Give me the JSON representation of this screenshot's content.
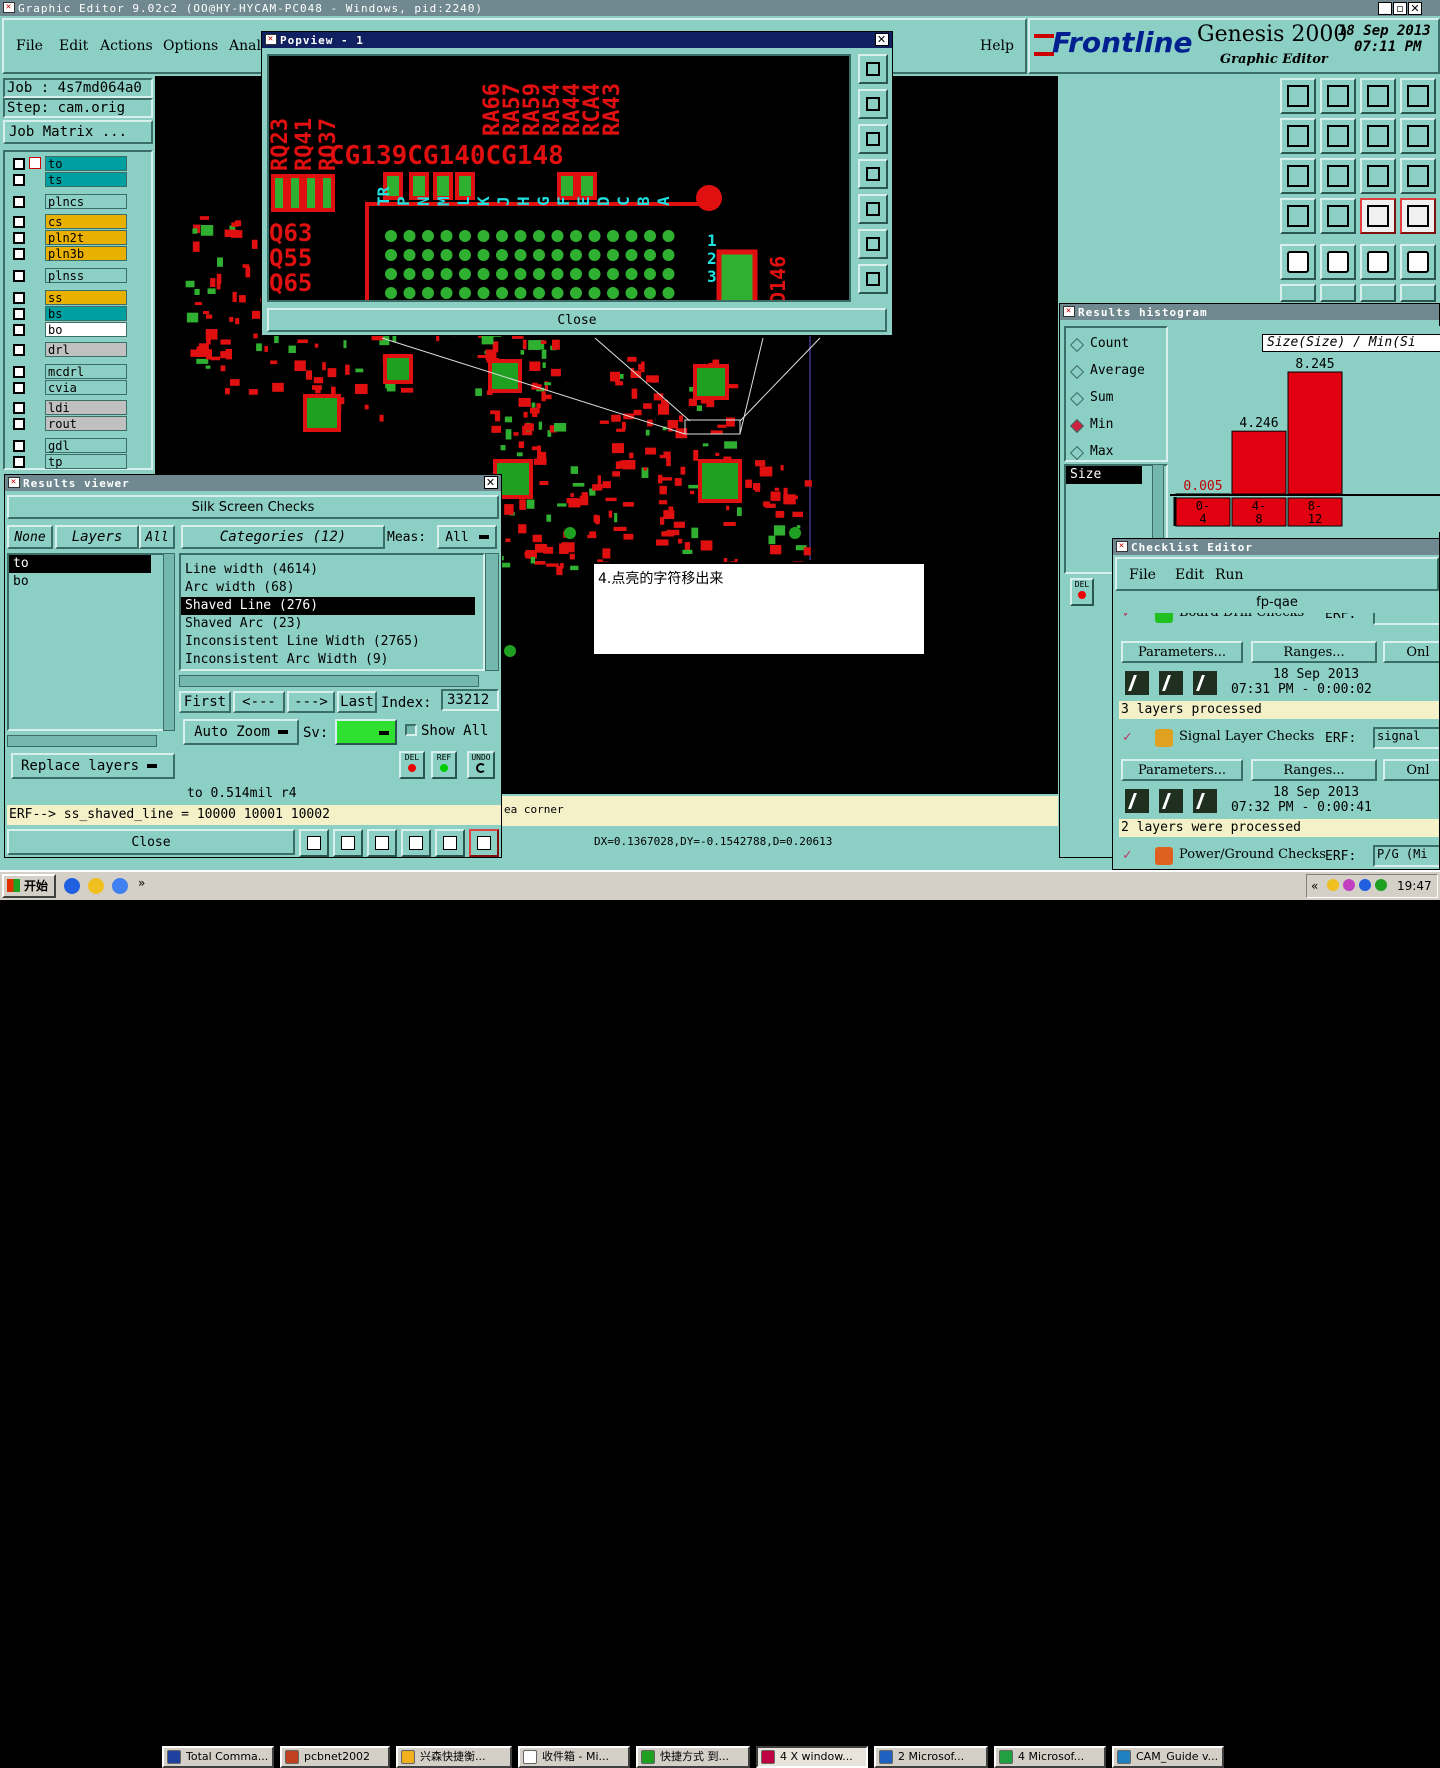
{
  "main": {
    "title": "Graphic Editor 9.02c2 (OO@HY-HYCAM-PC048 - Windows, pid:2240)",
    "menu": [
      "File",
      "Edit",
      "Actions",
      "Options",
      "Analy"
    ],
    "help": "Help",
    "brand": "Frontline",
    "product": "Genesis 2000",
    "subtitle": "Graphic Editor",
    "date": "18 Sep 2013",
    "time": "07:11 PM",
    "job": "Job : 4s7md064a0",
    "step": "Step: cam.orig",
    "job_matrix": "Job Matrix ...",
    "status_text": "ea corner",
    "coords": "DX=0.1367028,DY=-0.1542788,D=0.20613"
  },
  "layers": [
    {
      "name": "to",
      "color": "#00a0a0"
    },
    {
      "name": "ts",
      "color": "#00a0a0"
    },
    {
      "name": "plncs",
      "color": "#8ccfc4"
    },
    {
      "name": "cs",
      "color": "#e8b000"
    },
    {
      "name": "pln2t",
      "color": "#e8b000"
    },
    {
      "name": "pln3b",
      "color": "#e8b000"
    },
    {
      "name": "plnss",
      "color": "#8ccfc4"
    },
    {
      "name": "ss",
      "color": "#e8b000"
    },
    {
      "name": "bs",
      "color": "#00a0a0"
    },
    {
      "name": "bo",
      "color": "#ffffff"
    },
    {
      "name": "drl",
      "color": "#c0c0c0"
    },
    {
      "name": "mcdrl",
      "color": "#8ccfc4"
    },
    {
      "name": "cvia",
      "color": "#8ccfc4"
    },
    {
      "name": "ldi",
      "color": "#c0c0c0"
    },
    {
      "name": "rout",
      "color": "#c0c0c0"
    },
    {
      "name": "gdl",
      "color": "#8ccfc4"
    },
    {
      "name": "tp",
      "color": "#8ccfc4"
    }
  ],
  "popview": {
    "title": "Popview - 1",
    "close": "Close",
    "labels_top": "RA66 RA57 RA59 RA54 RA44 RCA4 RA43",
    "labels_left": "RQ23 RQ41 RQ37",
    "cg_text": "CG139CG140CG148",
    "q_labels": [
      "Q63",
      "Q55",
      "Q65"
    ],
    "d_label": "D146",
    "cyan_text": "TR P N M L K J H G F E D C B A"
  },
  "results_viewer": {
    "title": "Results viewer",
    "heading": "Silk Screen Checks",
    "none": "None",
    "layers_btn": "Layers",
    "all_btn": "All",
    "layers": [
      "to",
      "bo"
    ],
    "categories_btn": "Categories (12)",
    "meas_label": "Meas:",
    "meas_value": "All",
    "categories": [
      "Line width (4614)",
      "Arc width (68)",
      "Shaved Line (276)",
      "Shaved Arc (23)",
      "Inconsistent Line Width (2765)",
      "Inconsistent Arc Width (9)"
    ],
    "first": "First",
    "prev": "<---",
    "next": "--->",
    "last": "Last",
    "index_label": "Index:",
    "index_value": "33212",
    "auto_zoom": "Auto Zoom",
    "sv_label": "Sv:",
    "show_all": "Show All",
    "replace_layers": "Replace layers",
    "del": "DEL",
    "ref": "REF",
    "undo": "UNDO",
    "info": "to 0.514mil  r4",
    "erf": "ERF--> ss_shaved_line = 10000 10001 10002",
    "close": "Close"
  },
  "note": {
    "text": "4.点亮的字符移出来"
  },
  "histogram": {
    "title": "Results histogram",
    "options": [
      "Count",
      "Average",
      "Sum",
      "Min",
      "Max"
    ],
    "selected": "Min",
    "size_item": "Size",
    "header": "Size(Size) / Min(Si",
    "del": "DEL",
    "chart_data": {
      "type": "bar",
      "categories": [
        "0-4",
        "4-8",
        "8-12"
      ],
      "values": [
        0.005,
        4.246,
        8.245
      ],
      "labels": [
        "0.005",
        "4.246",
        "8.245"
      ],
      "tick_labels": [
        [
          "0-",
          "4"
        ],
        [
          "4-",
          "8"
        ],
        [
          "8-",
          "12"
        ]
      ]
    }
  },
  "checklist": {
    "title": "Checklist Editor",
    "menu": [
      "File",
      "Edit",
      "Run"
    ],
    "name": "fp-qae",
    "first_check": "Board-Drill Checks",
    "erf_label": "ERF:",
    "parameters": "Parameters...",
    "ranges": "Ranges...",
    "onl": "Onl",
    "checks": [
      {
        "name": "Signal Layer Checks",
        "erf": "signal",
        "date": "18 Sep 2013",
        "time": "07:32 PM - 0:00:41",
        "status": "2 layers were processed"
      },
      {
        "name": "Power/Ground Checks",
        "erf": "P/G (Mi",
        "date": "",
        "time": "",
        "status": ""
      }
    ],
    "first_date": "18 Sep 2013",
    "first_time": "07:31 PM - 0:00:02",
    "first_status": "3 layers processed"
  },
  "taskbar": {
    "start": "开始",
    "items": [
      "Total Comma...",
      "pcbnet2002",
      "兴森快捷衡...",
      "收件箱 - Mi...",
      "快捷方式 到...",
      "4 X window...",
      "2 Microsof...",
      "4 Microsof...",
      "CAM_Guide v..."
    ],
    "clock": "19:47"
  }
}
